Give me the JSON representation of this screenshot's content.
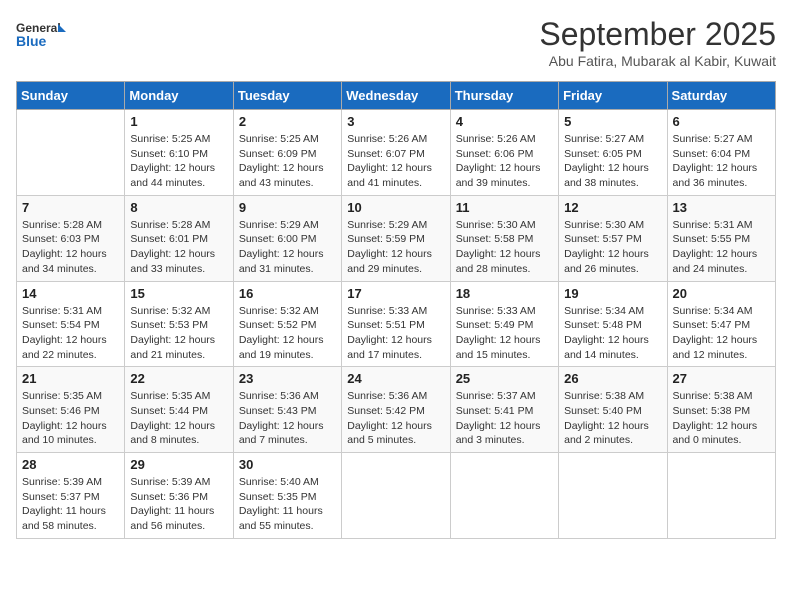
{
  "header": {
    "logo_line1": "General",
    "logo_line2": "Blue",
    "month": "September 2025",
    "location": "Abu Fatira, Mubarak al Kabir, Kuwait"
  },
  "days_of_week": [
    "Sunday",
    "Monday",
    "Tuesday",
    "Wednesday",
    "Thursday",
    "Friday",
    "Saturday"
  ],
  "weeks": [
    [
      {
        "day": "",
        "sunrise": "",
        "sunset": "",
        "daylight": ""
      },
      {
        "day": "1",
        "sunrise": "Sunrise: 5:25 AM",
        "sunset": "Sunset: 6:10 PM",
        "daylight": "Daylight: 12 hours and 44 minutes."
      },
      {
        "day": "2",
        "sunrise": "Sunrise: 5:25 AM",
        "sunset": "Sunset: 6:09 PM",
        "daylight": "Daylight: 12 hours and 43 minutes."
      },
      {
        "day": "3",
        "sunrise": "Sunrise: 5:26 AM",
        "sunset": "Sunset: 6:07 PM",
        "daylight": "Daylight: 12 hours and 41 minutes."
      },
      {
        "day": "4",
        "sunrise": "Sunrise: 5:26 AM",
        "sunset": "Sunset: 6:06 PM",
        "daylight": "Daylight: 12 hours and 39 minutes."
      },
      {
        "day": "5",
        "sunrise": "Sunrise: 5:27 AM",
        "sunset": "Sunset: 6:05 PM",
        "daylight": "Daylight: 12 hours and 38 minutes."
      },
      {
        "day": "6",
        "sunrise": "Sunrise: 5:27 AM",
        "sunset": "Sunset: 6:04 PM",
        "daylight": "Daylight: 12 hours and 36 minutes."
      }
    ],
    [
      {
        "day": "7",
        "sunrise": "Sunrise: 5:28 AM",
        "sunset": "Sunset: 6:03 PM",
        "daylight": "Daylight: 12 hours and 34 minutes."
      },
      {
        "day": "8",
        "sunrise": "Sunrise: 5:28 AM",
        "sunset": "Sunset: 6:01 PM",
        "daylight": "Daylight: 12 hours and 33 minutes."
      },
      {
        "day": "9",
        "sunrise": "Sunrise: 5:29 AM",
        "sunset": "Sunset: 6:00 PM",
        "daylight": "Daylight: 12 hours and 31 minutes."
      },
      {
        "day": "10",
        "sunrise": "Sunrise: 5:29 AM",
        "sunset": "Sunset: 5:59 PM",
        "daylight": "Daylight: 12 hours and 29 minutes."
      },
      {
        "day": "11",
        "sunrise": "Sunrise: 5:30 AM",
        "sunset": "Sunset: 5:58 PM",
        "daylight": "Daylight: 12 hours and 28 minutes."
      },
      {
        "day": "12",
        "sunrise": "Sunrise: 5:30 AM",
        "sunset": "Sunset: 5:57 PM",
        "daylight": "Daylight: 12 hours and 26 minutes."
      },
      {
        "day": "13",
        "sunrise": "Sunrise: 5:31 AM",
        "sunset": "Sunset: 5:55 PM",
        "daylight": "Daylight: 12 hours and 24 minutes."
      }
    ],
    [
      {
        "day": "14",
        "sunrise": "Sunrise: 5:31 AM",
        "sunset": "Sunset: 5:54 PM",
        "daylight": "Daylight: 12 hours and 22 minutes."
      },
      {
        "day": "15",
        "sunrise": "Sunrise: 5:32 AM",
        "sunset": "Sunset: 5:53 PM",
        "daylight": "Daylight: 12 hours and 21 minutes."
      },
      {
        "day": "16",
        "sunrise": "Sunrise: 5:32 AM",
        "sunset": "Sunset: 5:52 PM",
        "daylight": "Daylight: 12 hours and 19 minutes."
      },
      {
        "day": "17",
        "sunrise": "Sunrise: 5:33 AM",
        "sunset": "Sunset: 5:51 PM",
        "daylight": "Daylight: 12 hours and 17 minutes."
      },
      {
        "day": "18",
        "sunrise": "Sunrise: 5:33 AM",
        "sunset": "Sunset: 5:49 PM",
        "daylight": "Daylight: 12 hours and 15 minutes."
      },
      {
        "day": "19",
        "sunrise": "Sunrise: 5:34 AM",
        "sunset": "Sunset: 5:48 PM",
        "daylight": "Daylight: 12 hours and 14 minutes."
      },
      {
        "day": "20",
        "sunrise": "Sunrise: 5:34 AM",
        "sunset": "Sunset: 5:47 PM",
        "daylight": "Daylight: 12 hours and 12 minutes."
      }
    ],
    [
      {
        "day": "21",
        "sunrise": "Sunrise: 5:35 AM",
        "sunset": "Sunset: 5:46 PM",
        "daylight": "Daylight: 12 hours and 10 minutes."
      },
      {
        "day": "22",
        "sunrise": "Sunrise: 5:35 AM",
        "sunset": "Sunset: 5:44 PM",
        "daylight": "Daylight: 12 hours and 8 minutes."
      },
      {
        "day": "23",
        "sunrise": "Sunrise: 5:36 AM",
        "sunset": "Sunset: 5:43 PM",
        "daylight": "Daylight: 12 hours and 7 minutes."
      },
      {
        "day": "24",
        "sunrise": "Sunrise: 5:36 AM",
        "sunset": "Sunset: 5:42 PM",
        "daylight": "Daylight: 12 hours and 5 minutes."
      },
      {
        "day": "25",
        "sunrise": "Sunrise: 5:37 AM",
        "sunset": "Sunset: 5:41 PM",
        "daylight": "Daylight: 12 hours and 3 minutes."
      },
      {
        "day": "26",
        "sunrise": "Sunrise: 5:38 AM",
        "sunset": "Sunset: 5:40 PM",
        "daylight": "Daylight: 12 hours and 2 minutes."
      },
      {
        "day": "27",
        "sunrise": "Sunrise: 5:38 AM",
        "sunset": "Sunset: 5:38 PM",
        "daylight": "Daylight: 12 hours and 0 minutes."
      }
    ],
    [
      {
        "day": "28",
        "sunrise": "Sunrise: 5:39 AM",
        "sunset": "Sunset: 5:37 PM",
        "daylight": "Daylight: 11 hours and 58 minutes."
      },
      {
        "day": "29",
        "sunrise": "Sunrise: 5:39 AM",
        "sunset": "Sunset: 5:36 PM",
        "daylight": "Daylight: 11 hours and 56 minutes."
      },
      {
        "day": "30",
        "sunrise": "Sunrise: 5:40 AM",
        "sunset": "Sunset: 5:35 PM",
        "daylight": "Daylight: 11 hours and 55 minutes."
      },
      {
        "day": "",
        "sunrise": "",
        "sunset": "",
        "daylight": ""
      },
      {
        "day": "",
        "sunrise": "",
        "sunset": "",
        "daylight": ""
      },
      {
        "day": "",
        "sunrise": "",
        "sunset": "",
        "daylight": ""
      },
      {
        "day": "",
        "sunrise": "",
        "sunset": "",
        "daylight": ""
      }
    ]
  ]
}
